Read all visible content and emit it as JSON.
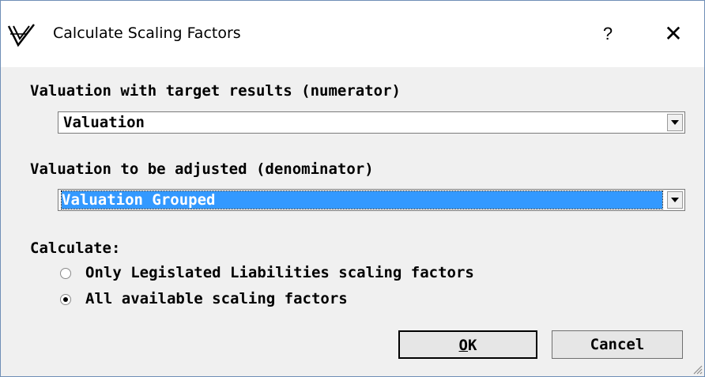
{
  "window": {
    "title": "Calculate Scaling Factors",
    "help_label": "?",
    "close_label": "✕"
  },
  "numerator": {
    "label": "Valuation with target results (numerator)",
    "value": "Valuation"
  },
  "denominator": {
    "label": "Valuation to be adjusted (denominator)",
    "value": "Valuation Grouped"
  },
  "calculate": {
    "label": "Calculate:",
    "options": [
      {
        "label": "Only Legislated Liabilities scaling factors",
        "checked": false
      },
      {
        "label": "All available scaling factors",
        "checked": true
      }
    ]
  },
  "buttons": {
    "ok_mnemonic": "O",
    "ok_rest": "K",
    "cancel": "Cancel"
  },
  "icons": {
    "app": "valuation-v-logo-icon",
    "dropdown": "chevron-down-icon",
    "resize": "resize-grip-icon"
  }
}
